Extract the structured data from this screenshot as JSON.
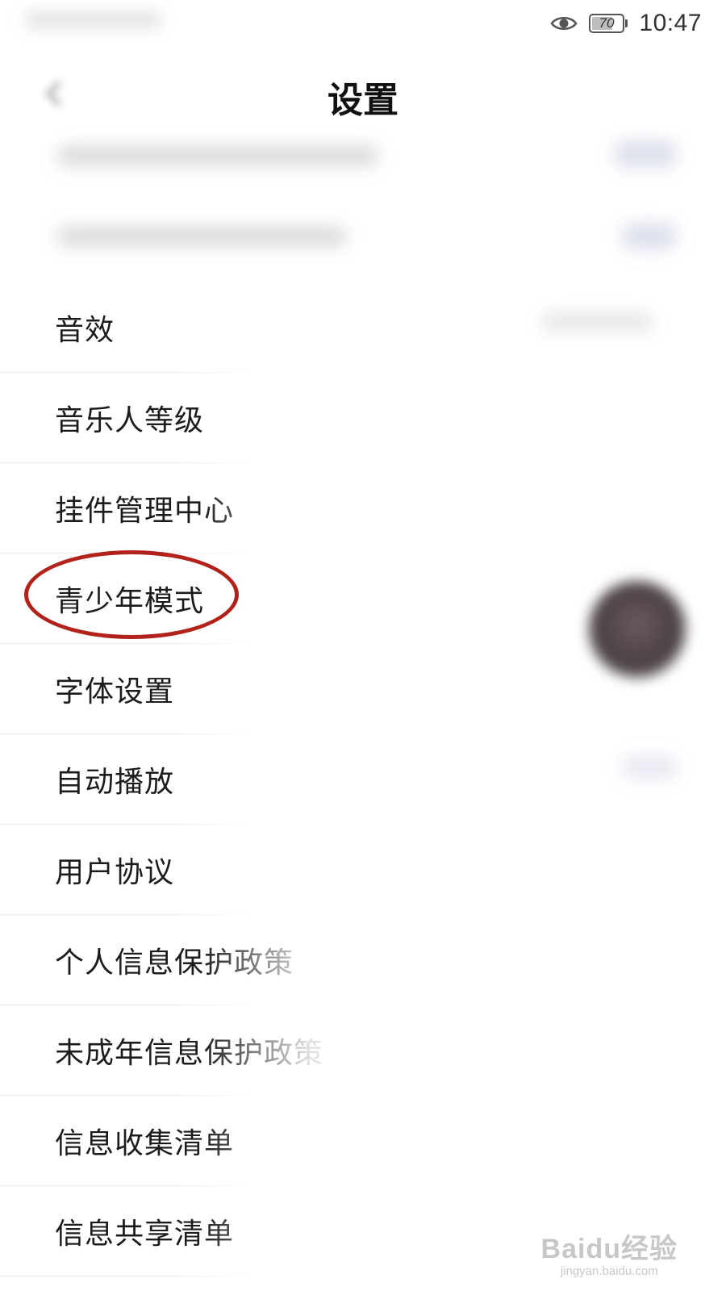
{
  "status_bar": {
    "battery_level": "70",
    "battery_fraction": 0.7,
    "time": "10:47",
    "icons": [
      "eye-icon",
      "battery-icon"
    ]
  },
  "header": {
    "title": "设置",
    "back_icon": "back-arrow-icon"
  },
  "menu": {
    "items": [
      {
        "label": "音效"
      },
      {
        "label": "音乐人等级"
      },
      {
        "label": "挂件管理中心"
      },
      {
        "label": "青少年模式",
        "highlighted": true
      },
      {
        "label": "字体设置"
      },
      {
        "label": "自动播放"
      },
      {
        "label": "用户协议"
      },
      {
        "label": "个人信息保护政策"
      },
      {
        "label": "未成年信息保护政策"
      },
      {
        "label": "信息收集清单"
      },
      {
        "label": "信息共享清单"
      }
    ]
  },
  "annotation": {
    "highlight_color": "#b3211b"
  },
  "watermark": {
    "logo": "Baidu经验",
    "url": "jingyan.baidu.com"
  }
}
